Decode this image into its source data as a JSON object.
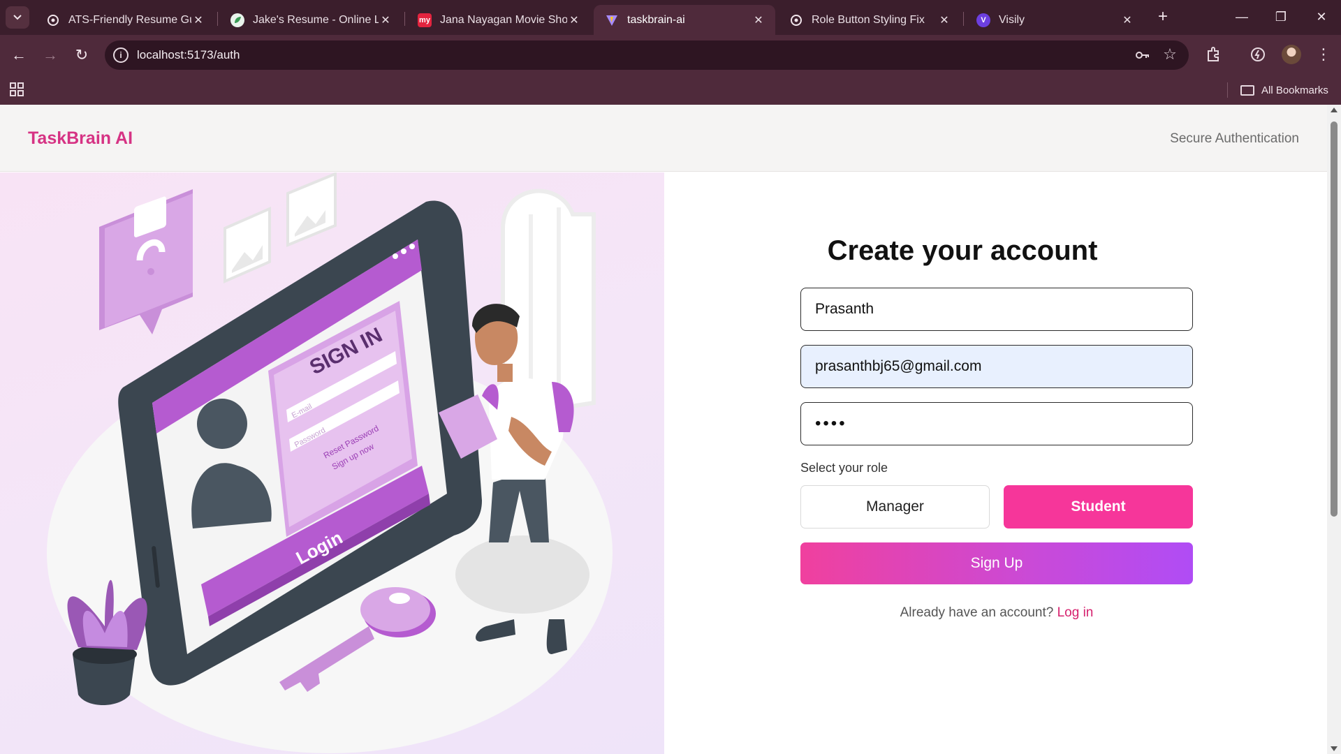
{
  "browser": {
    "tabs": [
      {
        "title": "ATS-Friendly Resume Guide",
        "icon": "openai-icon",
        "active": false
      },
      {
        "title": "Jake's Resume - Online LaTeX",
        "icon": "overleaf-icon",
        "active": false
      },
      {
        "title": "Jana Nayagan Movie Show",
        "icon": "bookmyshow-icon",
        "active": false
      },
      {
        "title": "taskbrain-ai",
        "icon": "vite-icon",
        "active": true
      },
      {
        "title": "Role Button Styling Fix",
        "icon": "openai-icon",
        "active": false
      },
      {
        "title": "Visily",
        "icon": "visily-icon",
        "active": false
      }
    ],
    "url": "localhost:5173/auth",
    "bookmarks_label": "All Bookmarks"
  },
  "header": {
    "brand": "TaskBrain AI",
    "tagline": "Secure Authentication"
  },
  "illustration": {
    "sign_in_text": "SIGN IN",
    "email_placeholder": "E-mail",
    "password_placeholder": "Password",
    "reset_text": "Reset Password",
    "signup_text": "Sign up now",
    "login_text": "Login"
  },
  "form": {
    "title": "Create your account",
    "name_value": "Prasanth",
    "email_value": "prasanthbj65@gmail.com",
    "password_value": "••••",
    "role_label": "Select your role",
    "roles": [
      "Manager",
      "Student"
    ],
    "selected_role": "Student",
    "submit_label": "Sign Up",
    "login_prompt": "Already have an account?",
    "login_link": "Log in"
  },
  "colors": {
    "brand": "#d63384",
    "student_selected": "#f6369a",
    "signup_gradient_start": "#f0409e",
    "signup_gradient_end": "#b04cf5",
    "login_link": "#d6216e",
    "chrome_tabbar": "#3b1e2c",
    "chrome_toolbar": "#4f2a3b"
  }
}
